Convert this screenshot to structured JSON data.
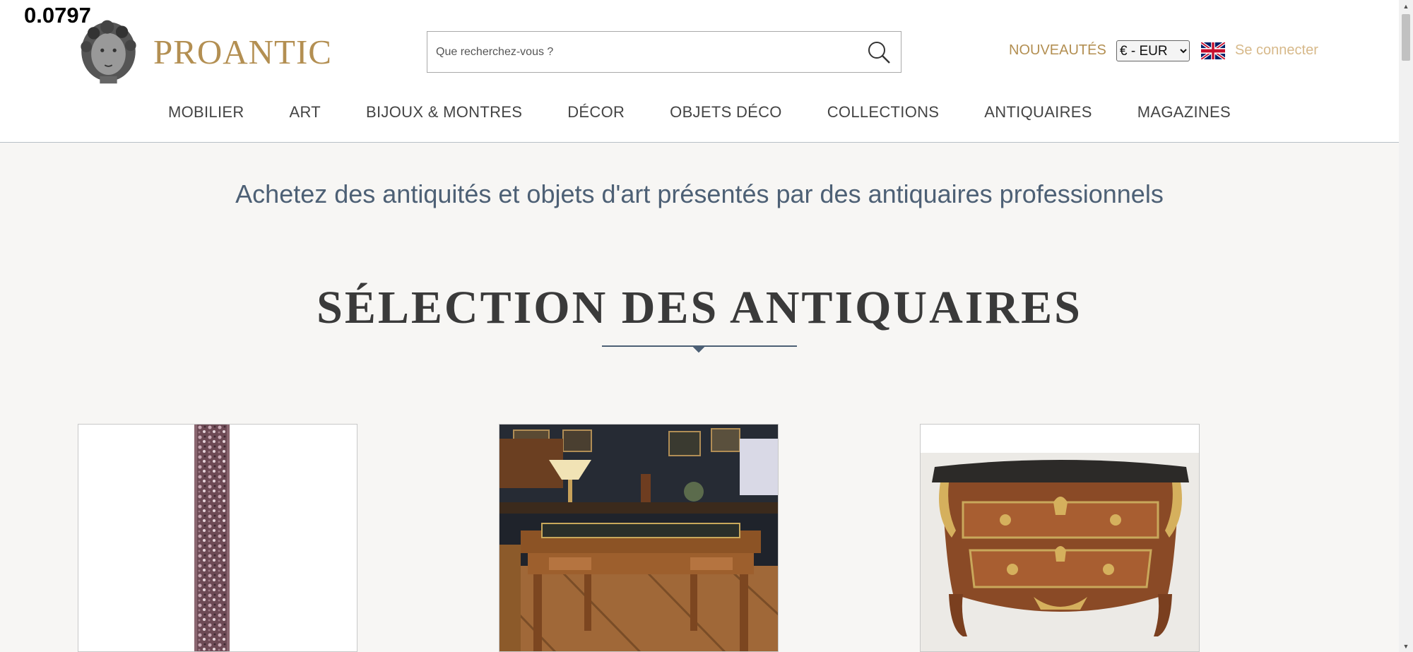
{
  "overlay_value": "0.0797",
  "brand": {
    "name": "PROANTIC",
    "color": "#b38f52"
  },
  "search": {
    "placeholder": "Que recherchez-vous ?",
    "icon": "search-icon"
  },
  "header_links": {
    "new": "NOUVEAUTÉS",
    "currency": "€ - EUR",
    "language_icon": "uk-flag-icon",
    "login": "Se connecter"
  },
  "nav": {
    "items": [
      "MOBILIER",
      "ART",
      "BIJOUX & MONTRES",
      "DÉCOR",
      "OBJETS DÉCO",
      "COLLECTIONS",
      "ANTIQUAIRES",
      "MAGAZINES"
    ]
  },
  "tagline": "Achetez des antiquités et objets d'art présentés par des antiquaires professionnels",
  "section_title": "SÉLECTION DES ANTIQUAIRES",
  "products": [
    {
      "image": "mosaic-column-image"
    },
    {
      "image": "antique-desk-image"
    },
    {
      "image": "marquetry-commode-image"
    }
  ]
}
